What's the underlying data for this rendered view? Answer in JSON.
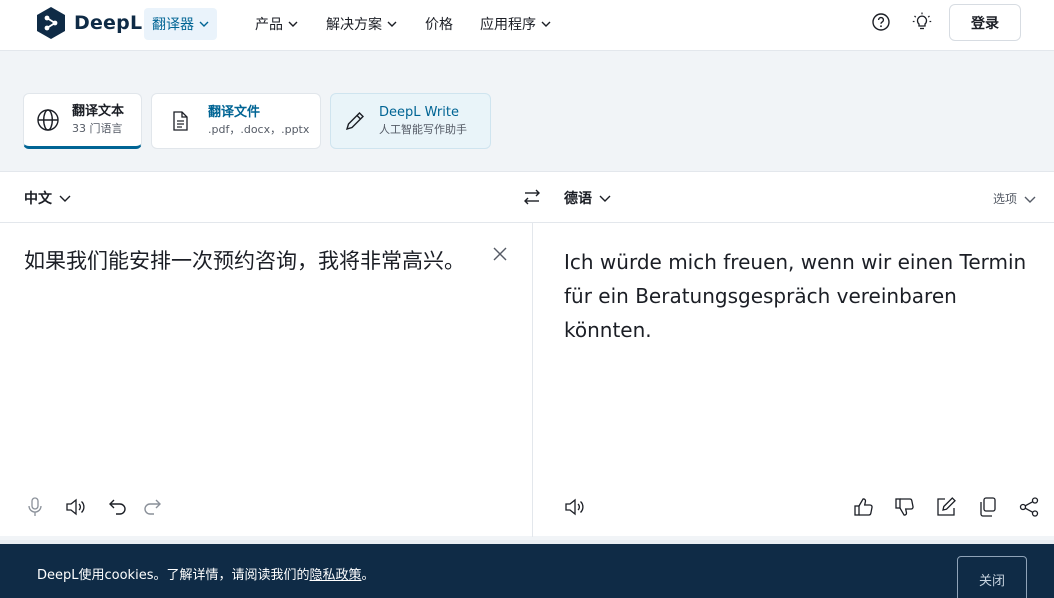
{
  "header": {
    "brand": "DeepL",
    "nav": [
      {
        "label": "翻译器"
      },
      {
        "label": "产品"
      },
      {
        "label": "解决方案"
      },
      {
        "label": "价格"
      },
      {
        "label": "应用程序"
      }
    ],
    "login_label": "登录",
    "icons": [
      "help-icon",
      "theme-lightbulb-icon"
    ]
  },
  "modes": [
    {
      "title": "翻译文本",
      "subtitle": "33 门语言",
      "icon": "globe-icon"
    },
    {
      "title": "翻译文件",
      "subtitle": ".pdf，.docx，.pptx",
      "icon": "document-icon"
    },
    {
      "title": "DeepL Write",
      "subtitle": "人工智能写作助手",
      "icon": "pen-icon"
    }
  ],
  "translator": {
    "source_lang": "中文",
    "target_lang": "德语",
    "options_label": "选项",
    "source_text": "如果我们能安排一次预约咨询，我将非常高兴。",
    "target_text": "Ich würde mich freuen, wenn wir einen Termin für ein Beratungsgespräch vereinbaren könnten."
  },
  "cookie": {
    "text": "DeepL使用cookies。了解详情，请阅读我们的",
    "link": "隐私政策",
    "suffix": "。",
    "close_label": "关闭"
  },
  "colors": {
    "brand_navy": "#0f2b46",
    "accent": "#006494",
    "active_bg": "#eaf3fb"
  }
}
